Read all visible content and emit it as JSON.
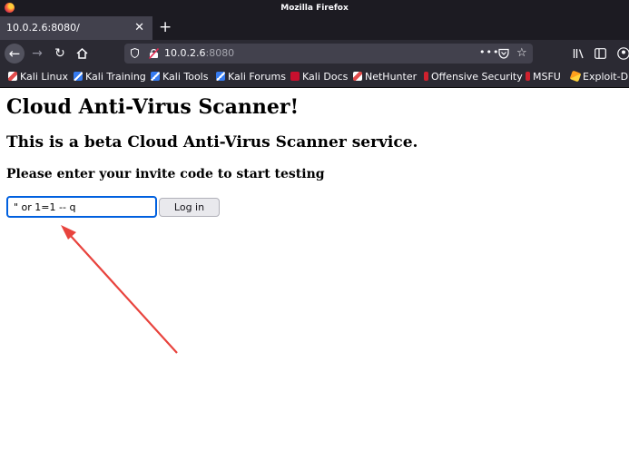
{
  "window": {
    "title": "Mozilla Firefox"
  },
  "tab": {
    "label": "10.0.2.6:8080/",
    "close_glyph": "✕",
    "new_tab_glyph": "+"
  },
  "navbar": {
    "url_host": "10.0.2.6",
    "url_port": ":8080",
    "page_actions_glyph": "•••"
  },
  "bookmarks": [
    {
      "label": "Kali Linux",
      "icon": "kali-dragon-icon"
    },
    {
      "label": "Kali Training",
      "icon": "kali-training-icon"
    },
    {
      "label": "Kali Tools",
      "icon": "kali-tools-icon"
    },
    {
      "label": "Kali Forums",
      "icon": "kali-forums-icon"
    },
    {
      "label": "Kali Docs",
      "icon": "kali-docs-icon"
    },
    {
      "label": "NetHunter",
      "icon": "nethunter-icon"
    },
    {
      "label": "Offensive Security",
      "icon": "offsec-icon"
    },
    {
      "label": "MSFU",
      "icon": "msfu-icon"
    },
    {
      "label": "Exploit-D",
      "icon": "exploit-db-icon"
    }
  ],
  "page": {
    "heading": "Cloud Anti-Virus Scanner!",
    "subheading": "This is a beta Cloud Anti-Virus Scanner service.",
    "prompt": "Please enter your invite code to start testing",
    "code_input_value": "\" or 1=1 -- q",
    "login_button_label": "Log in"
  },
  "colors": {
    "chrome_dark": "#1c1b22",
    "toolbar": "#2b2a33",
    "focus_ring": "#0060df",
    "annotation_arrow": "#e8433d"
  }
}
